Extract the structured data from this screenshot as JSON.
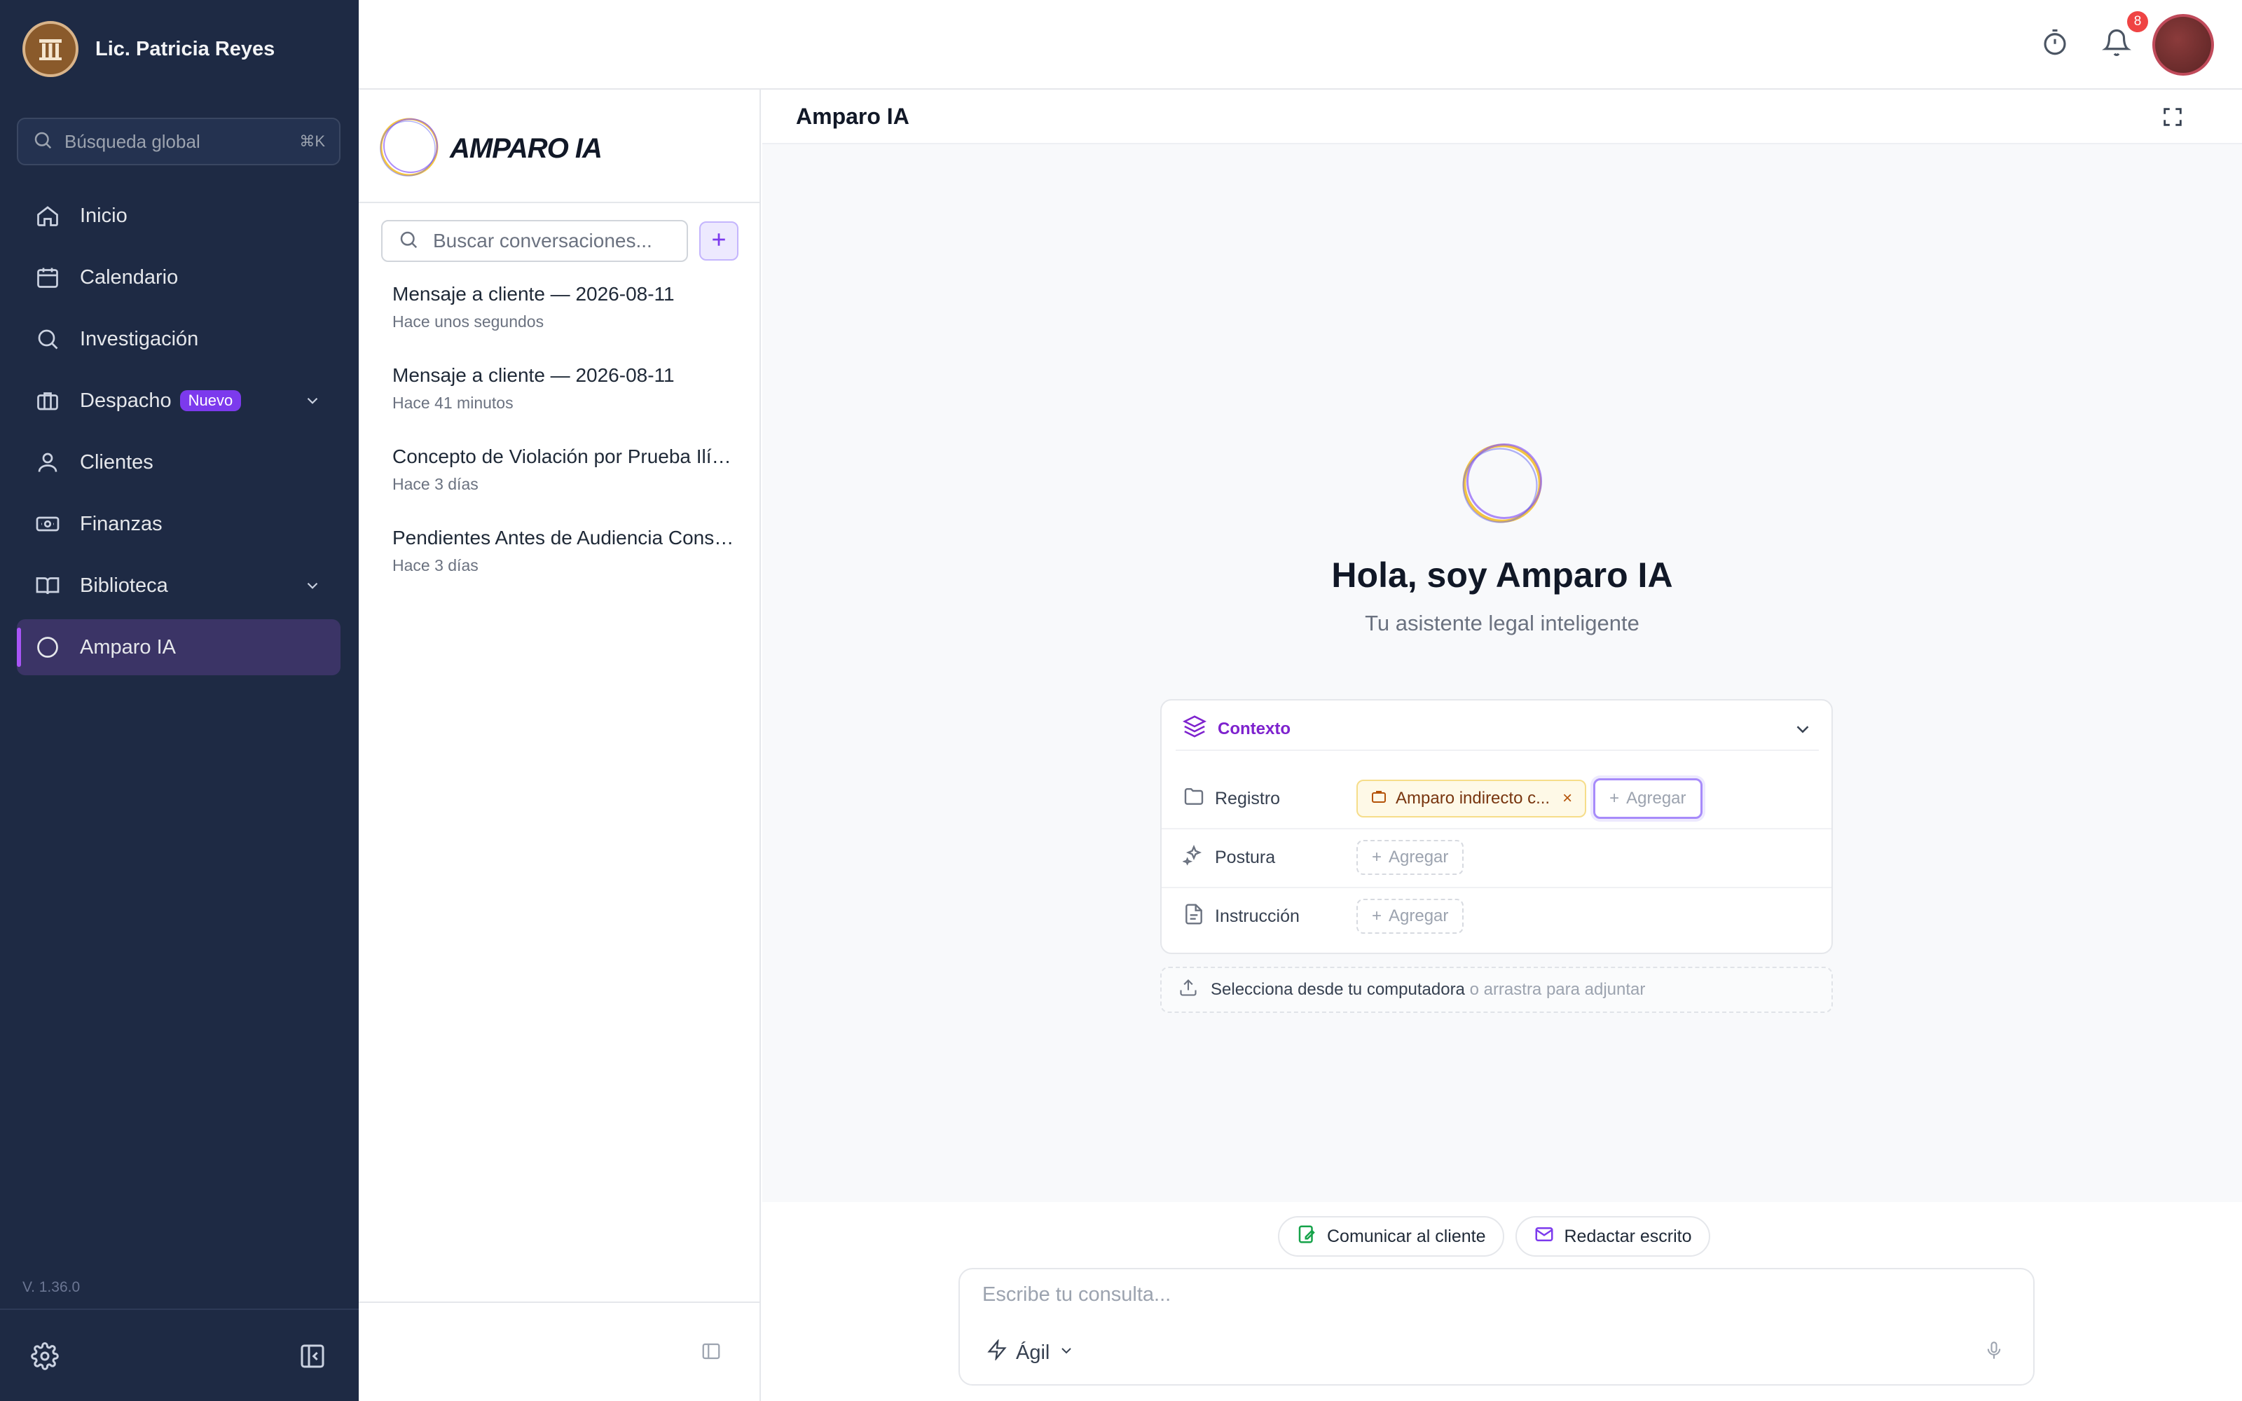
{
  "user": {
    "name": "Lic. Patricia Reyes"
  },
  "sidebar": {
    "search_placeholder": "Búsqueda global",
    "search_shortcut": "⌘K",
    "items": [
      {
        "label": "Inicio",
        "icon": "home-icon"
      },
      {
        "label": "Calendario",
        "icon": "calendar-icon"
      },
      {
        "label": "Investigación",
        "icon": "search-icon"
      },
      {
        "label": "Despacho",
        "icon": "briefcase-icon",
        "badge": "Nuevo",
        "expandable": true
      },
      {
        "label": "Clientes",
        "icon": "user-icon"
      },
      {
        "label": "Finanzas",
        "icon": "money-icon"
      },
      {
        "label": "Biblioteca",
        "icon": "book-icon",
        "expandable": true
      },
      {
        "label": "Amparo IA",
        "icon": "circle-icon",
        "active": true
      }
    ],
    "version": "V. 1.36.0"
  },
  "topbar": {
    "notification_count": "8"
  },
  "conversations": {
    "brand": "AMPARO IA",
    "search_placeholder": "Buscar conversaciones...",
    "items": [
      {
        "title": "Mensaje a cliente — 2026-08-11",
        "time": "Hace unos segundos"
      },
      {
        "title": "Mensaje a cliente — 2026-08-11",
        "time": "Hace 41 minutos"
      },
      {
        "title": "Concepto de Violación por Prueba Ilícita",
        "time": "Hace 3 días"
      },
      {
        "title": "Pendientes Antes de Audiencia Constitucional",
        "time": "Hace 3 días"
      }
    ]
  },
  "main": {
    "title": "Amparo IA",
    "hero_title": "Hola, soy Amparo IA",
    "hero_subtitle": "Tu asistente legal inteligente",
    "context": {
      "title": "Contexto",
      "rows": [
        {
          "label": "Registro",
          "chip": "Amparo indirecto c...",
          "add": "Agregar"
        },
        {
          "label": "Postura",
          "add": "Agregar"
        },
        {
          "label": "Instrucción",
          "add": "Agregar"
        }
      ]
    },
    "attach_primary": "Selecciona desde tu computadora",
    "attach_secondary": "o arrastra para adjuntar",
    "actions": {
      "communicate": "Comunicar al cliente",
      "draft": "Redactar escrito"
    },
    "composer_placeholder": "Escribe tu consulta...",
    "mode": "Ágil"
  },
  "colors": {
    "sidebar_bg": "#1e2a44",
    "accent": "#7c3aed",
    "active_bg": "#3b3466",
    "badge_red": "#ef4444"
  }
}
